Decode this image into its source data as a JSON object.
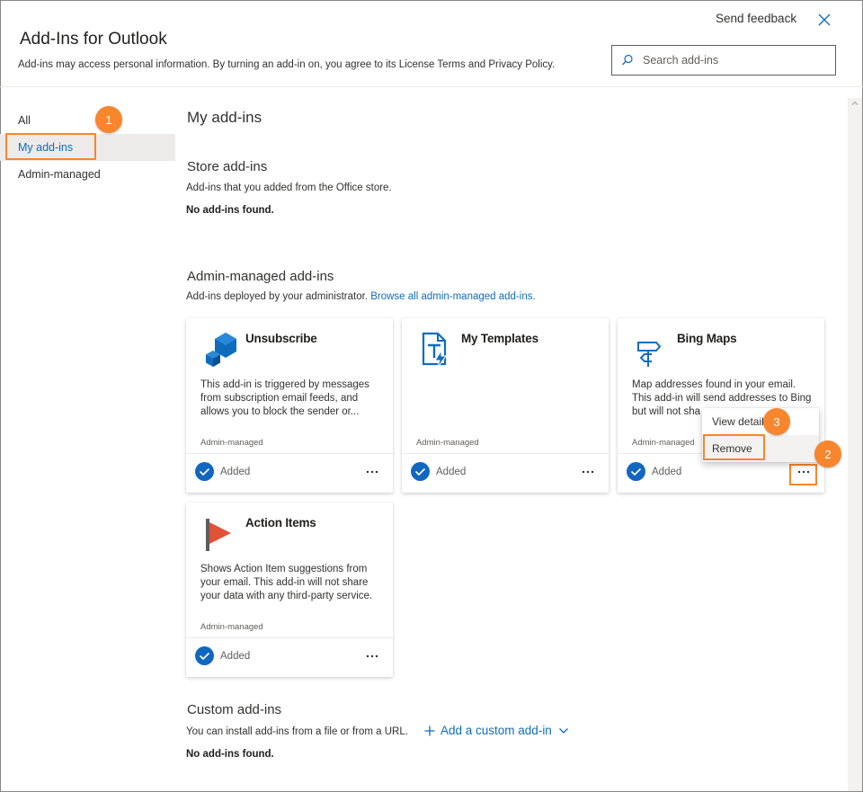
{
  "header": {
    "title": "Add-Ins for Outlook",
    "description": "Add-ins may access personal information. By turning an add-in on, you agree to its License Terms and Privacy Policy.",
    "send_feedback": "Send feedback",
    "search_placeholder": "Search add-ins"
  },
  "sidebar": {
    "items": [
      {
        "label": "All"
      },
      {
        "label": "My add-ins",
        "selected": true
      },
      {
        "label": "Admin-managed"
      }
    ]
  },
  "main": {
    "title": "My add-ins",
    "store": {
      "title": "Store add-ins",
      "description": "Add-ins that you added from the Office store.",
      "empty": "No add-ins found."
    },
    "admin": {
      "title": "Admin-managed add-ins",
      "description": "Add-ins deployed by your administrator.",
      "link": "Browse all admin-managed add-ins."
    },
    "cards": [
      {
        "name": "Unsubscribe",
        "icon": "cube-icon",
        "description": "This add-in is triggered by messages from subscription email feeds, and allows you to block the sender or...",
        "managed": "Admin-managed",
        "status": "Added"
      },
      {
        "name": "My Templates",
        "icon": "template-icon",
        "description": "",
        "managed": "Admin-managed",
        "status": "Added"
      },
      {
        "name": "Bing Maps",
        "icon": "signpost-icon",
        "description": "Map addresses found in your email. This add-in will send addresses to Bing but will not sha",
        "managed": "Admin-managed",
        "status": "Added"
      },
      {
        "name": "Action Items",
        "icon": "flag-icon",
        "description": "Shows Action Item suggestions from your email. This add-in will not share your data with any third-party service.",
        "managed": "Admin-managed",
        "status": "Added"
      }
    ],
    "context_menu": {
      "items": [
        "View details",
        "Remove"
      ]
    },
    "custom": {
      "title": "Custom add-ins",
      "description": "You can install add-ins from a file or from a URL.",
      "add_link": "Add a custom add-in",
      "empty": "No add-ins found."
    }
  },
  "step_badges": [
    "1",
    "2",
    "3"
  ],
  "colors": {
    "accent": "#0f6cbd",
    "check": "#1167c0",
    "highlight": "#f7862d",
    "selected_bg": "#edebe9"
  }
}
